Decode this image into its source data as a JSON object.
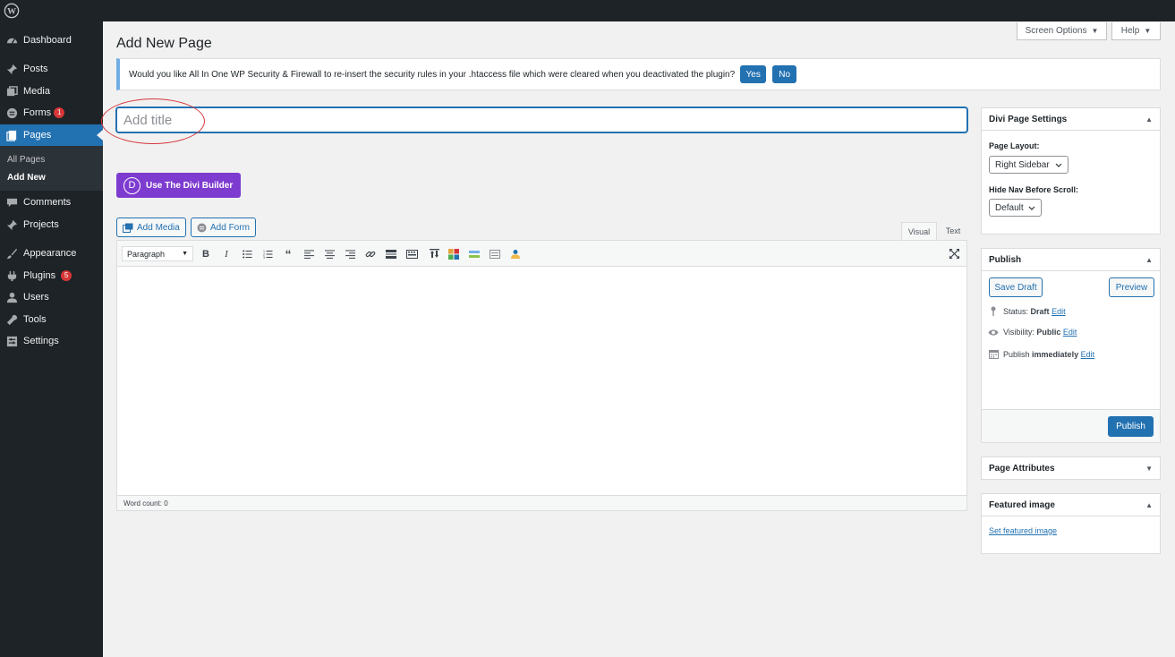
{
  "sidebar": {
    "items": [
      {
        "label": "Dashboard",
        "icon": "dashboard-icon"
      },
      {
        "label": "Posts",
        "icon": "pin-icon"
      },
      {
        "label": "Media",
        "icon": "media-icon"
      },
      {
        "label": "Forms",
        "icon": "forms-icon",
        "badge": "1"
      },
      {
        "label": "Pages",
        "icon": "pages-icon"
      },
      {
        "label": "Comments",
        "icon": "comments-icon"
      },
      {
        "label": "Projects",
        "icon": "pin-icon"
      },
      {
        "label": "Appearance",
        "icon": "brush-icon"
      },
      {
        "label": "Plugins",
        "icon": "plugins-icon",
        "badge": "5"
      },
      {
        "label": "Users",
        "icon": "users-icon"
      },
      {
        "label": "Tools",
        "icon": "wrench-icon"
      },
      {
        "label": "Settings",
        "icon": "settings-icon"
      }
    ],
    "submenu": [
      "All Pages",
      "Add New"
    ]
  },
  "header": {
    "screen_options": "Screen Options",
    "help": "Help",
    "page_title": "Add New Page"
  },
  "notice": {
    "text": "Would you like All In One WP Security & Firewall to re-insert the security rules in your .htaccess file which were cleared when you deactivated the plugin?",
    "yes": "Yes",
    "no": "No"
  },
  "title_input": {
    "placeholder": "Add title",
    "value": ""
  },
  "divi": {
    "button": "Use The Divi Builder",
    "logo_letter": "D"
  },
  "media": {
    "add_media": "Add Media",
    "add_form": "Add Form"
  },
  "editor": {
    "tabs": [
      "Visual",
      "Text"
    ],
    "active_tab": "Visual",
    "format_select": "Paragraph",
    "word_count": "Word count: 0"
  },
  "divi_settings": {
    "title": "Divi Page Settings",
    "layout_label": "Page Layout:",
    "layout_value": "Right Sidebar",
    "hide_nav_label": "Hide Nav Before Scroll:",
    "hide_nav_value": "Default"
  },
  "publish": {
    "title": "Publish",
    "save_draft": "Save Draft",
    "preview": "Preview",
    "status_label": "Status:",
    "status_value": "Draft",
    "visibility_label": "Visibility:",
    "visibility_value": "Public",
    "publish_label": "Publish",
    "publish_value": "immediately",
    "edit": "Edit",
    "publish_button": "Publish"
  },
  "page_attributes": {
    "title": "Page Attributes"
  },
  "featured_image": {
    "title": "Featured image",
    "link": "Set featured image"
  },
  "colors": {
    "admin_dark": "#1d2327",
    "accent": "#2271b1",
    "divi_purple": "#7e3bd0",
    "badge_red": "#d63638",
    "annotation_red": "#d6373b"
  }
}
